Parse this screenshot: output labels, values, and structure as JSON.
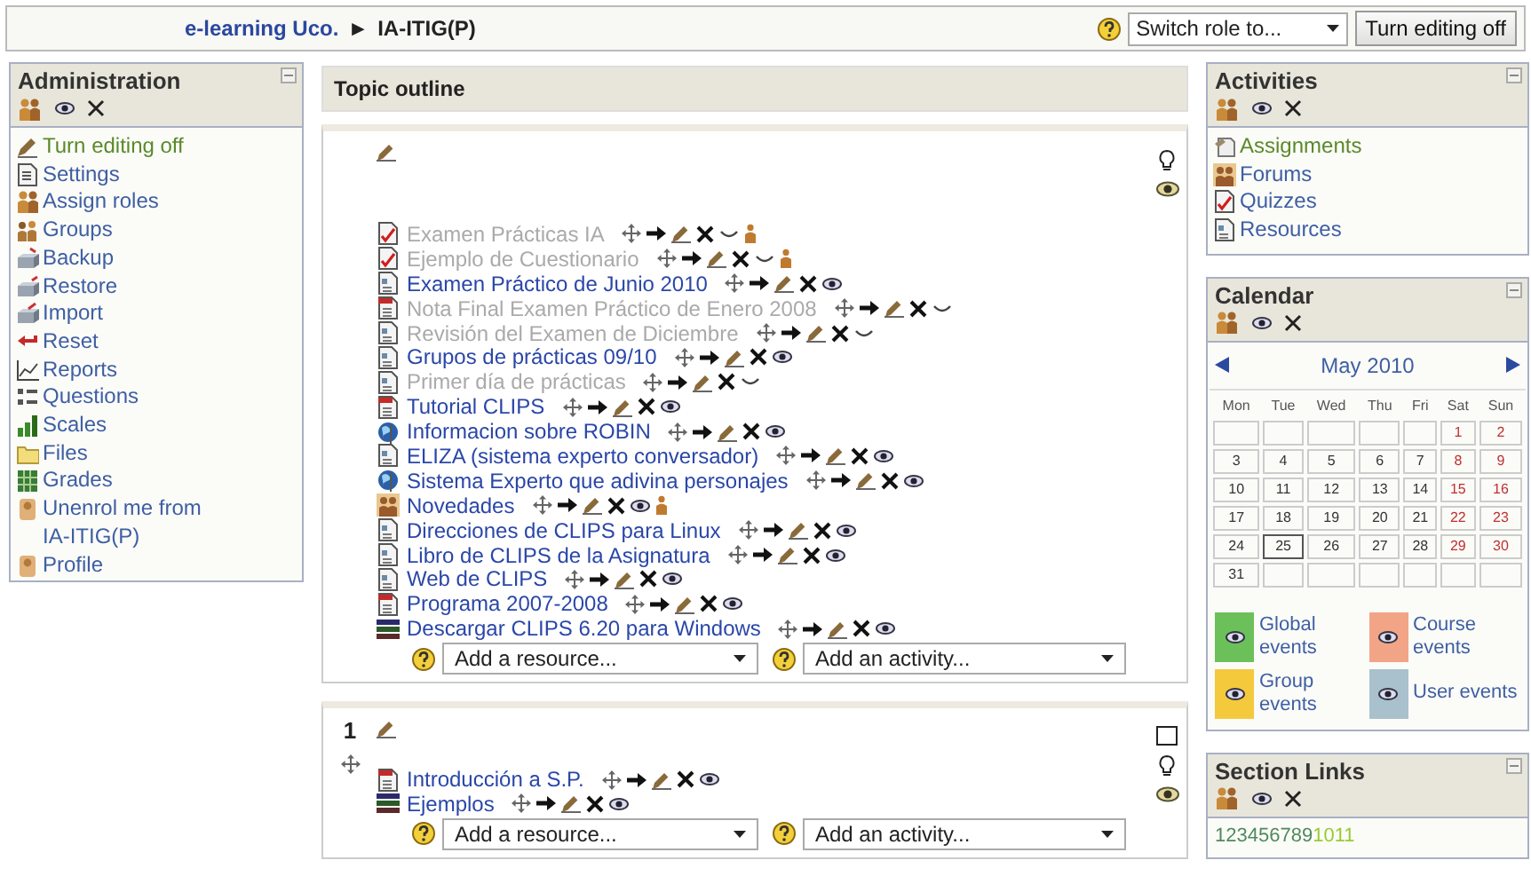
{
  "header": {
    "breadcrumb": [
      "e-learning Uco.",
      "IA-ITIG(P)"
    ],
    "separator": "►",
    "role_select": {
      "value": "Switch role to..."
    },
    "edit_button": "Turn editing off"
  },
  "administration": {
    "title": "Administration",
    "items": [
      {
        "label": "Turn editing off",
        "kind": "edit"
      },
      {
        "label": "Settings",
        "kind": "settings"
      },
      {
        "label": "Assign roles",
        "kind": "roles"
      },
      {
        "label": "Groups",
        "kind": "groups"
      },
      {
        "label": "Backup",
        "kind": "backup"
      },
      {
        "label": "Restore",
        "kind": "restore"
      },
      {
        "label": "Import",
        "kind": "import"
      },
      {
        "label": "Reset",
        "kind": "reset"
      },
      {
        "label": "Reports",
        "kind": "reports"
      },
      {
        "label": "Questions",
        "kind": "questions"
      },
      {
        "label": "Scales",
        "kind": "scales"
      },
      {
        "label": "Files",
        "kind": "files"
      },
      {
        "label": "Grades",
        "kind": "grades"
      },
      {
        "label": "Unenrol me from IA-ITIG(P)",
        "kind": "person"
      },
      {
        "label": "Profile",
        "kind": "person"
      }
    ]
  },
  "topic": {
    "title": "Topic outline",
    "sections": [
      {
        "items": [
          {
            "label": "Examen Prácticas IA",
            "kind": "quiz",
            "hidden": true,
            "group": true
          },
          {
            "label": "Ejemplo de Cuestionario",
            "kind": "quiz",
            "hidden": true,
            "group": true
          },
          {
            "label": "Examen Práctico de Junio 2010",
            "kind": "file",
            "hidden": false,
            "group": false
          },
          {
            "label": "Nota Final Examen Práctico de Enero 2008",
            "kind": "pdf",
            "hidden": true,
            "group": false
          },
          {
            "label": "Revisión del Examen de Diciembre",
            "kind": "file",
            "hidden": true,
            "group": false
          },
          {
            "label": "Grupos de prácticas 09/10",
            "kind": "file",
            "hidden": false,
            "group": false
          },
          {
            "label": "Primer día de prácticas",
            "kind": "file",
            "hidden": true,
            "group": false
          },
          {
            "label": "Tutorial CLIPS",
            "kind": "pdf",
            "hidden": false,
            "group": false
          },
          {
            "label": "Informacion sobre ROBIN",
            "kind": "web",
            "hidden": false,
            "group": false
          },
          {
            "label": "ELIZA (sistema experto conversador)",
            "kind": "file",
            "hidden": false,
            "group": false
          },
          {
            "label": "Sistema Experto que adivina personajes",
            "kind": "web",
            "hidden": false,
            "group": false
          },
          {
            "label": "Novedades",
            "kind": "forum",
            "hidden": false,
            "group": true
          },
          {
            "label": "Direcciones de CLIPS para Linux",
            "kind": "file",
            "hidden": false,
            "group": false
          },
          {
            "label": "Libro de CLIPS de la Asignatura",
            "kind": "file",
            "hidden": false,
            "group": false
          },
          {
            "label": "Web de CLIPS",
            "kind": "file",
            "hidden": false,
            "group": false
          },
          {
            "label": "Programa 2007-2008",
            "kind": "pdf",
            "hidden": false,
            "group": false
          },
          {
            "label": "Descargar CLIPS 6.20 para Windows",
            "kind": "book",
            "hidden": false,
            "group": false
          }
        ],
        "add_resource": "Add a resource...",
        "add_activity": "Add an activity..."
      },
      {
        "number": "1",
        "items": [
          {
            "label": "Introducción a S.P.",
            "kind": "pdf",
            "hidden": false,
            "group": false
          },
          {
            "label": "Ejemplos",
            "kind": "book",
            "hidden": false,
            "group": false
          }
        ],
        "add_resource": "Add a resource...",
        "add_activity": "Add an activity..."
      }
    ]
  },
  "activities": {
    "title": "Activities",
    "items": [
      {
        "label": "Assignments",
        "kind": "assignment"
      },
      {
        "label": "Forums",
        "kind": "forum"
      },
      {
        "label": "Quizzes",
        "kind": "quiz"
      },
      {
        "label": "Resources",
        "kind": "file"
      }
    ]
  },
  "calendar": {
    "title": "Calendar",
    "month": "May 2010",
    "weekdays": [
      "Mon",
      "Tue",
      "Wed",
      "Thu",
      "Fri",
      "Sat",
      "Sun"
    ],
    "weeks": [
      [
        {
          "day": "1",
          "today": false
        },
        {
          "day": "2",
          "today": false
        }
      ],
      [
        {
          "day": "3",
          "today": false
        },
        {
          "day": "4",
          "today": false
        },
        {
          "day": "5",
          "today": false
        },
        {
          "day": "6",
          "today": false
        },
        {
          "day": "7",
          "today": false
        },
        {
          "day": "8",
          "today": false
        },
        {
          "day": "9",
          "today": false
        }
      ],
      [
        {
          "day": "10",
          "today": false
        },
        {
          "day": "11",
          "today": false
        },
        {
          "day": "12",
          "today": false
        },
        {
          "day": "13",
          "today": false
        },
        {
          "day": "14",
          "today": false
        },
        {
          "day": "15",
          "today": false
        },
        {
          "day": "16",
          "today": false
        }
      ],
      [
        {
          "day": "17",
          "today": false
        },
        {
          "day": "18",
          "today": false
        },
        {
          "day": "19",
          "today": false
        },
        {
          "day": "20",
          "today": false
        },
        {
          "day": "21",
          "today": false
        },
        {
          "day": "22",
          "today": false
        },
        {
          "day": "23",
          "today": false
        }
      ],
      [
        {
          "day": "24",
          "today": false
        },
        {
          "day": "25",
          "today": true
        },
        {
          "day": "26",
          "today": false
        },
        {
          "day": "27",
          "today": false
        },
        {
          "day": "28",
          "today": false
        },
        {
          "day": "29",
          "today": false
        },
        {
          "day": "30",
          "today": false
        }
      ],
      [
        {
          "day": "31",
          "today": false
        }
      ]
    ],
    "events_key": [
      {
        "label": "Global events",
        "color": "#6cc05a"
      },
      {
        "label": "Course events",
        "color": "#f2a487"
      },
      {
        "label": "Group events",
        "color": "#f5c93c"
      },
      {
        "label": "User events",
        "color": "#a9c1cc"
      }
    ]
  },
  "section_links": {
    "title": "Section Links",
    "links": [
      {
        "text": "1",
        "color": "#4f8a5c"
      },
      {
        "text": "2",
        "color": "#4f8a5c"
      },
      {
        "text": "3",
        "color": "#4f8a5c"
      },
      {
        "text": "4",
        "color": "#4f8a5c"
      },
      {
        "text": "5",
        "color": "#4f8a5c"
      },
      {
        "text": "6",
        "color": "#4f8a5c"
      },
      {
        "text": "7",
        "color": "#4f8a5c"
      },
      {
        "text": "8",
        "color": "#4f8a5c"
      },
      {
        "text": "9",
        "color": "#4f8a5c"
      },
      {
        "text": "10",
        "color": "#99cc33"
      },
      {
        "text": "11",
        "color": "#99cc33"
      }
    ]
  }
}
